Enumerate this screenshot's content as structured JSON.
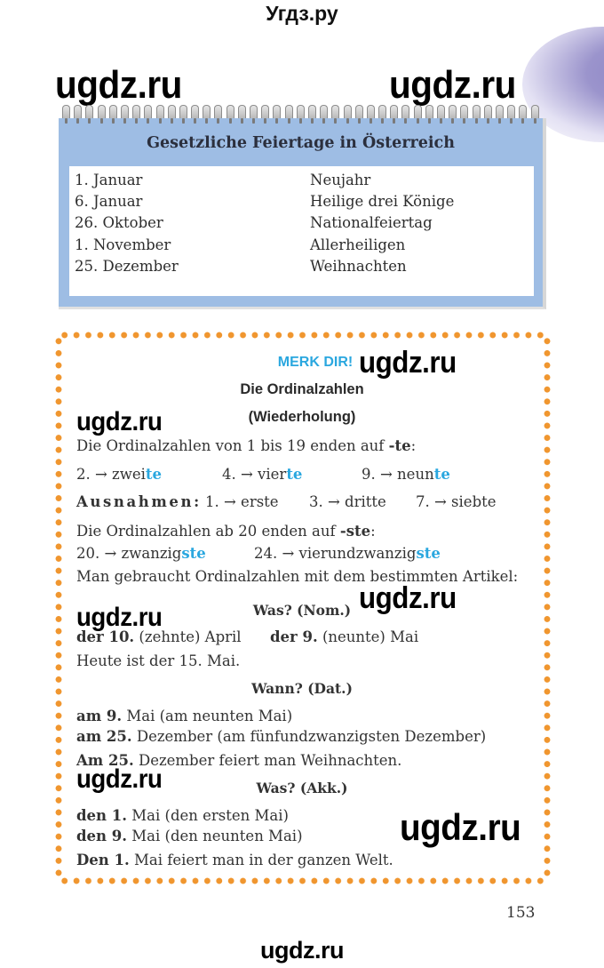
{
  "site_title": "Угдз.ру",
  "watermarks": {
    "text": "ugdz.ru"
  },
  "calendar": {
    "title": "Gesetzliche Feiertage in Österreich",
    "rows": [
      {
        "date": "1. Januar",
        "holiday": "Neujahr"
      },
      {
        "date": "6. Januar",
        "holiday": "Heilige drei Könige"
      },
      {
        "date": "26. Oktober",
        "holiday": "Nationalfeiertag"
      },
      {
        "date": "1. November",
        "holiday": "Allerheiligen"
      },
      {
        "date": "25. Dezember",
        "holiday": "Weihnachten"
      }
    ]
  },
  "merk": {
    "label": "MERK DIR!",
    "title": "Die Ordinalzahlen",
    "subtitle": "(Wiederholung)",
    "rule1": {
      "text": "Die Ordinalzahlen von 1 bis 19 enden auf ",
      "suffix": "-te",
      "end": ":"
    },
    "examples1": [
      {
        "num": "2. → zwei",
        "ending": "te"
      },
      {
        "num": "4. → vier",
        "ending": "te"
      },
      {
        "num": "9. → neun",
        "ending": "te"
      }
    ],
    "exceptions": {
      "label": "Ausnahmen:",
      "items": [
        "1. → erste",
        "3. → dritte",
        "7. → siebte"
      ]
    },
    "rule2": {
      "text": "Die Ordinalzahlen ab 20 enden auf ",
      "suffix": "-ste",
      "end": ":"
    },
    "examples2": [
      {
        "num": "20. → zwanzig",
        "ending": "ste"
      },
      {
        "num": "24. → vierundzwanzig",
        "ending": "ste"
      }
    ],
    "article_rule": "Man gebraucht Ordinalzahlen mit dem bestimmten Artikel:",
    "nom": {
      "heading": "Was? (Nom.)",
      "ex1_bold": "der 10.",
      "ex1_rest": " (zehnte) April",
      "ex2_bold": "der 9.",
      "ex2_rest": " (neunte) Mai",
      "sentence": "Heute ist der 15. Mai."
    },
    "dat": {
      "heading": "Wann? (Dat.)",
      "lines": [
        {
          "bold": "am 9.",
          "rest": " Mai (am neunten Mai)"
        },
        {
          "bold": "am 25.",
          "rest": " Dezember (am fünfundzwanzigsten Dezember)"
        }
      ],
      "sentence": {
        "bold": "Am 25.",
        "rest": " Dezember feiert man Weihnachten."
      }
    },
    "akk": {
      "heading": "Was? (Akk.)",
      "lines": [
        {
          "bold": "den 1.",
          "rest": " Mai (den ersten Mai)"
        },
        {
          "bold": "den 9.",
          "rest": " Mai (den neunten Mai)"
        }
      ],
      "sentence": {
        "bold": "Den 1.",
        "rest": " Mai feiert man in der ganzen Welt."
      }
    }
  },
  "page_number": "153",
  "colors": {
    "accent_blue": "#2aa7df",
    "dot_orange": "#f0962f",
    "calendar_blue": "#9ebde4"
  }
}
